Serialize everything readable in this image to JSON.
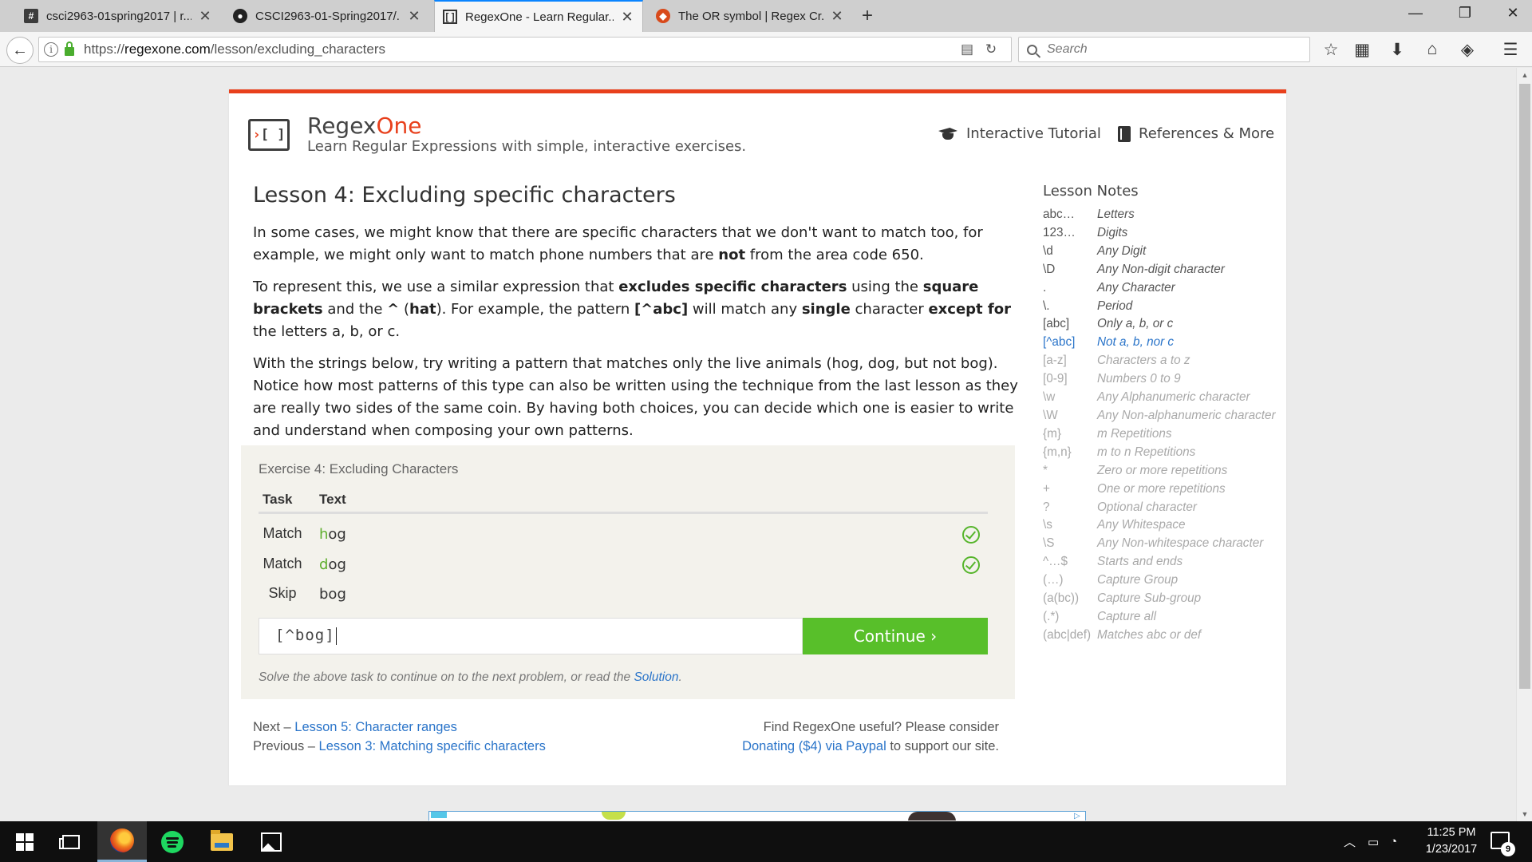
{
  "browser": {
    "tabs": [
      {
        "title": "csci2963-01spring2017 | r...",
        "icon": "slack-hash-icon",
        "active": false
      },
      {
        "title": "CSCI2963-01-Spring2017/...",
        "icon": "github-icon",
        "active": false
      },
      {
        "title": "RegexOne - Learn Regular...",
        "icon": "regexone-icon",
        "active": true
      },
      {
        "title": "The OR symbol | Regex Cr...",
        "icon": "regexcrossword-icon",
        "active": false
      }
    ],
    "url_prefix": "https://",
    "url_domain": "regexone.com",
    "url_path": "/lesson/excluding_characters",
    "search_placeholder": "Search"
  },
  "site": {
    "brand_main": "Regex",
    "brand_accent": "One",
    "tagline": "Learn Regular Expressions with simple, interactive exercises.",
    "nav_tutorial": "Interactive Tutorial",
    "nav_references": "References & More",
    "accent_color": "#e8401c"
  },
  "lesson": {
    "title": "Lesson 4: Excluding specific characters",
    "p1_a": "In some cases, we might know that there are specific characters that we don't want to match too, for example, we might only want to match phone numbers that are ",
    "p1_b": "not",
    "p1_c": " from the area code 650.",
    "p2_a": "To represent this, we use a similar expression that ",
    "p2_b": "excludes specific characters",
    "p2_c": " using the ",
    "p2_d": "square brackets",
    "p2_e": " and the ",
    "p2_f": "^",
    "p2_g": " (",
    "p2_h": "hat",
    "p2_i": "). For example, the pattern ",
    "p2_j": "[^abc]",
    "p2_k": " will match any ",
    "p2_l": "single",
    "p2_m": " character ",
    "p2_n": "except for",
    "p2_o": " the letters a, b, or c.",
    "p3": "With the strings below, try writing a pattern that matches only the live animals (hog, dog, but not bog). Notice how most patterns of this type can also be written using the technique from the last lesson as they are really two sides of the same coin. By having both choices, you can decide which one is easier to write and understand when composing your own patterns."
  },
  "exercise": {
    "title": "Exercise 4: Excluding Characters",
    "col_task": "Task",
    "col_text": "Text",
    "rows": [
      {
        "task": "Match",
        "hl": "h",
        "rest": "og",
        "passed": true
      },
      {
        "task": "Match",
        "hl": "d",
        "rest": "og",
        "passed": true
      },
      {
        "task": "Skip",
        "hl": "",
        "rest": "bog",
        "passed": false
      }
    ],
    "input_value": "[^bog]",
    "continue_label": "Continue ›",
    "hint_text": "Solve the above task to continue on to the next problem, or read the ",
    "hint_link": "Solution",
    "hint_end": ".",
    "success_color": "#58bf2a"
  },
  "pager": {
    "next_prefix": "Next – ",
    "next_link": "Lesson 5: Character ranges",
    "prev_prefix": "Previous – ",
    "prev_link": "Lesson 3: Matching specific characters",
    "donate_line1": "Find RegexOne useful? Please consider",
    "donate_link": "Donating ($4) via Paypal",
    "donate_end": " to support our site."
  },
  "notes": {
    "title": "Lesson Notes",
    "items": [
      {
        "code": "abc…",
        "desc": "Letters",
        "state": "done"
      },
      {
        "code": "123…",
        "desc": "Digits",
        "state": "done"
      },
      {
        "code": "\\d",
        "desc": "Any Digit",
        "state": "done"
      },
      {
        "code": "\\D",
        "desc": "Any Non-digit character",
        "state": "done"
      },
      {
        "code": ".",
        "desc": "Any Character",
        "state": "done"
      },
      {
        "code": "\\.",
        "desc": "Period",
        "state": "done"
      },
      {
        "code": "[abc]",
        "desc": "Only a, b, or c",
        "state": "done"
      },
      {
        "code": "[^abc]",
        "desc": "Not a, b, nor c",
        "state": "current"
      },
      {
        "code": "[a-z]",
        "desc": "Characters a to z",
        "state": "todo"
      },
      {
        "code": "[0-9]",
        "desc": "Numbers 0 to 9",
        "state": "todo"
      },
      {
        "code": "\\w",
        "desc": "Any Alphanumeric character",
        "state": "todo"
      },
      {
        "code": "\\W",
        "desc": "Any Non-alphanumeric character",
        "state": "todo"
      },
      {
        "code": "{m}",
        "desc": "m Repetitions",
        "state": "todo"
      },
      {
        "code": "{m,n}",
        "desc": "m to n Repetitions",
        "state": "todo"
      },
      {
        "code": "*",
        "desc": "Zero or more repetitions",
        "state": "todo"
      },
      {
        "code": "+",
        "desc": "One or more repetitions",
        "state": "todo"
      },
      {
        "code": "?",
        "desc": "Optional character",
        "state": "todo"
      },
      {
        "code": "\\s",
        "desc": "Any Whitespace",
        "state": "todo"
      },
      {
        "code": "\\S",
        "desc": "Any Non-whitespace character",
        "state": "todo"
      },
      {
        "code": "^…$",
        "desc": "Starts and ends",
        "state": "todo"
      },
      {
        "code": "(…)",
        "desc": "Capture Group",
        "state": "todo"
      },
      {
        "code": "(a(bc))",
        "desc": "Capture Sub-group",
        "state": "todo"
      },
      {
        "code": "(.*)",
        "desc": "Capture all",
        "state": "todo"
      },
      {
        "code": "(abc|def)",
        "desc": "Matches abc or def",
        "state": "todo"
      }
    ]
  },
  "taskbar": {
    "time": "11:25 PM",
    "date": "1/23/2017",
    "notification_count": "9"
  }
}
